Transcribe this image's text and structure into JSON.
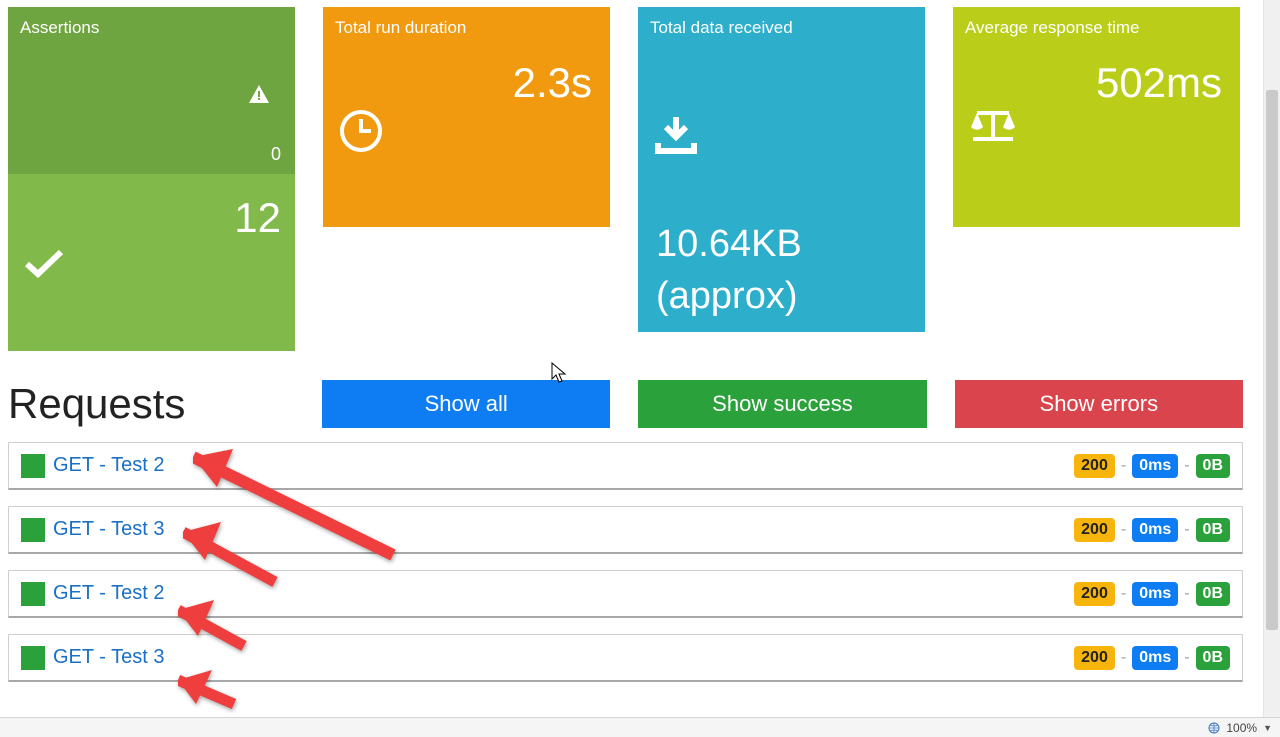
{
  "cards": {
    "assertions": {
      "title": "Assertions",
      "fail_count": "0",
      "pass_count": "12"
    },
    "duration": {
      "title": "Total run duration",
      "value": "2.3s"
    },
    "data": {
      "title": "Total data received",
      "value": "10.64KB",
      "suffix": "(approx)"
    },
    "avg": {
      "title": "Average response time",
      "value": "502ms"
    }
  },
  "requests_heading": "Requests",
  "filters": {
    "all": "Show all",
    "success": "Show success",
    "errors": "Show errors"
  },
  "requests": [
    {
      "name": "GET - Test 2",
      "status": "200",
      "time": "0ms",
      "size": "0B"
    },
    {
      "name": "GET - Test 3",
      "status": "200",
      "time": "0ms",
      "size": "0B"
    },
    {
      "name": "GET - Test 2",
      "status": "200",
      "time": "0ms",
      "size": "0B"
    },
    {
      "name": "GET - Test 3",
      "status": "200",
      "time": "0ms",
      "size": "0B"
    }
  ],
  "statusbar": {
    "zoom": "100%"
  }
}
